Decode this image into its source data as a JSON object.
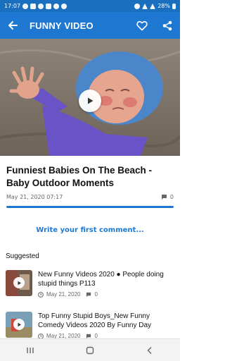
{
  "status_bar": {
    "time": "17:07",
    "battery": "28%"
  },
  "app_bar": {
    "title": "FUNNY VIDEO"
  },
  "video": {
    "title": "Funniest Babies On The Beach - Baby Outdoor Moments",
    "date": "May 21, 2020 07:17",
    "comment_count": "0"
  },
  "comments": {
    "write_prompt": "Write your first comment..."
  },
  "suggested": {
    "heading": "Suggested",
    "items": [
      {
        "title": "New Funny Videos 2020 ● People doing stupid things P113",
        "date": "May 21, 2020",
        "comments": "0"
      },
      {
        "title": "Top Funny Stupid Boys_New Funny Comedy Videos 2020 By Funny Day",
        "date": "May 21, 2020",
        "comments": "0"
      }
    ]
  },
  "colors": {
    "primary": "#1e78d2",
    "status_bar": "#1b6fbf"
  }
}
